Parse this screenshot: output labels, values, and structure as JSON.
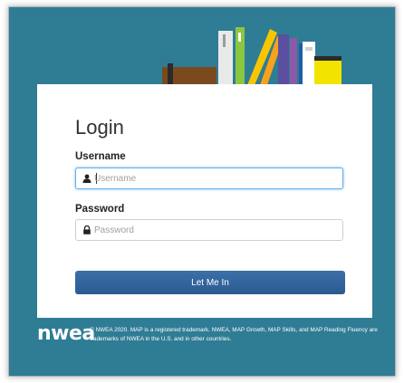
{
  "login": {
    "title": "Login",
    "username_label": "Username",
    "username_placeholder": "Username",
    "username_value": "",
    "password_label": "Password",
    "password_placeholder": "Password",
    "password_value": "",
    "submit_label": "Let Me In"
  },
  "footer": {
    "logo_text": "nwea",
    "copyright": "© NWEA 2020. MAP is a registered trademark. NWEA, MAP Growth, MAP Skills, and MAP Reading Fluency are trademarks of NWEA in the U.S. and in other countries."
  },
  "icons": {
    "username": "user-icon",
    "password": "lock-icon"
  },
  "colors": {
    "background": "#2f7c95",
    "button": "#2f5f97",
    "focus": "#66afe9"
  }
}
